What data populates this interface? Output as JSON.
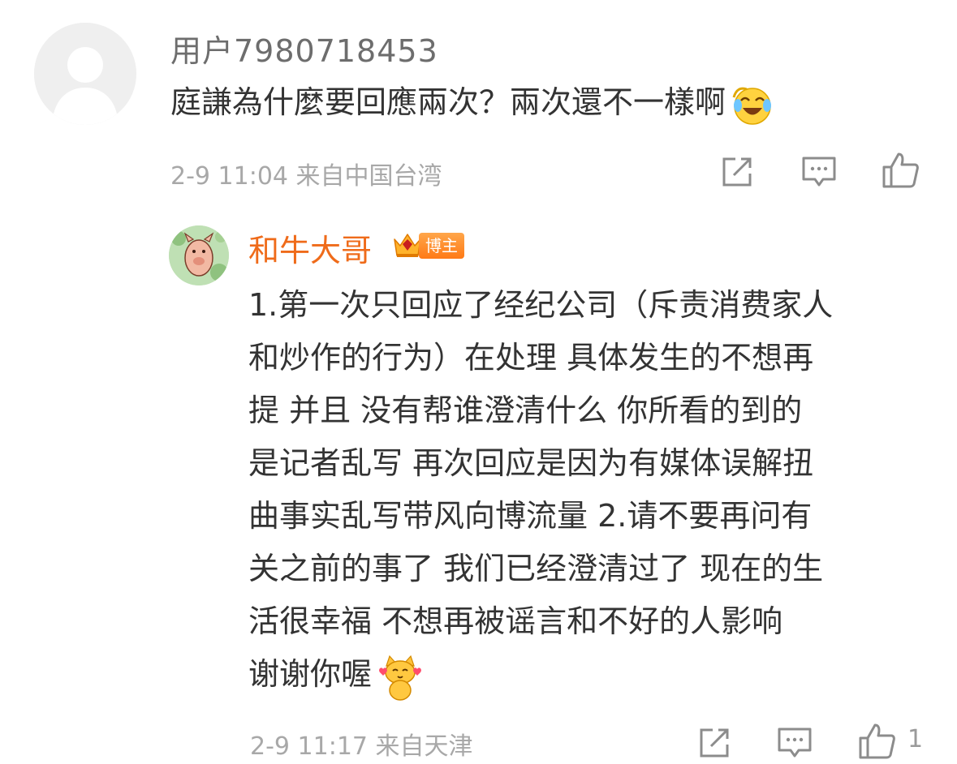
{
  "comment": {
    "username": "用户7980718453",
    "text": "庭謙為什麼要回應兩次？兩次還不一樣啊",
    "emoji": "laughing-crying-emoji",
    "meta": "2-9 11:04  来自中国台湾"
  },
  "reply": {
    "username": "和牛大哥",
    "badge": "博主",
    "lines": [
      "1.第一次只回应了经纪公司（斥责消费家人",
      "和炒作的行为）在处理 具体发生的不想再",
      "提 并且 没有帮谁澄清什么 你所看的到的",
      "是记者乱写 再次回应是因为有媒体误解扭",
      "曲事实乱写带风向博流量  2.请不要再问有",
      "关之前的事了 我们已经澄清过了 现在的生",
      "活很幸福 不想再被谣言和不好的人影响",
      "谢谢你喔"
    ],
    "emoji": "cat-hearts-emoji",
    "meta": "2-9 11:17  来自天津",
    "like_count": "1"
  },
  "colors": {
    "username": "#6d6d6d",
    "text": "#333333",
    "meta": "#a8a8a8",
    "reply_name": "#ef6b1a",
    "badge": "#ff8a20"
  }
}
